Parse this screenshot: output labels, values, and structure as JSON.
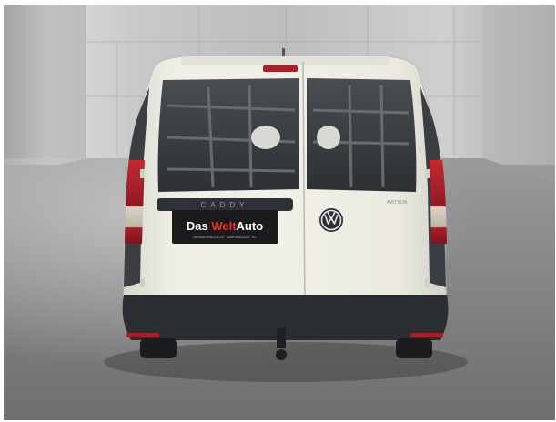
{
  "photo": {
    "subject": "rear-view-of-white-van-in-concrete-studio",
    "colors": {
      "wall": "#bdbdbd",
      "floor": "#8a8a8a",
      "van_body": "#ecebe2",
      "bumper": "#2a2d31",
      "glass": "#3b3f44",
      "tail_light": "#b3232e",
      "plate_bg": "#1b1b1b",
      "plate_accent": "#e63325"
    }
  },
  "van": {
    "model_badge": "CADDY",
    "brand_logo_icon": "vw-logo-icon",
    "trim_badge": "4MOTION"
  },
  "dealer_plate": {
    "text_part1": "Das ",
    "text_part2": "Welt",
    "text_part3": "Auto",
    "small_print": "DIRKSEN FRISCH & CO. · 12345 Musterstadt · Tel."
  }
}
